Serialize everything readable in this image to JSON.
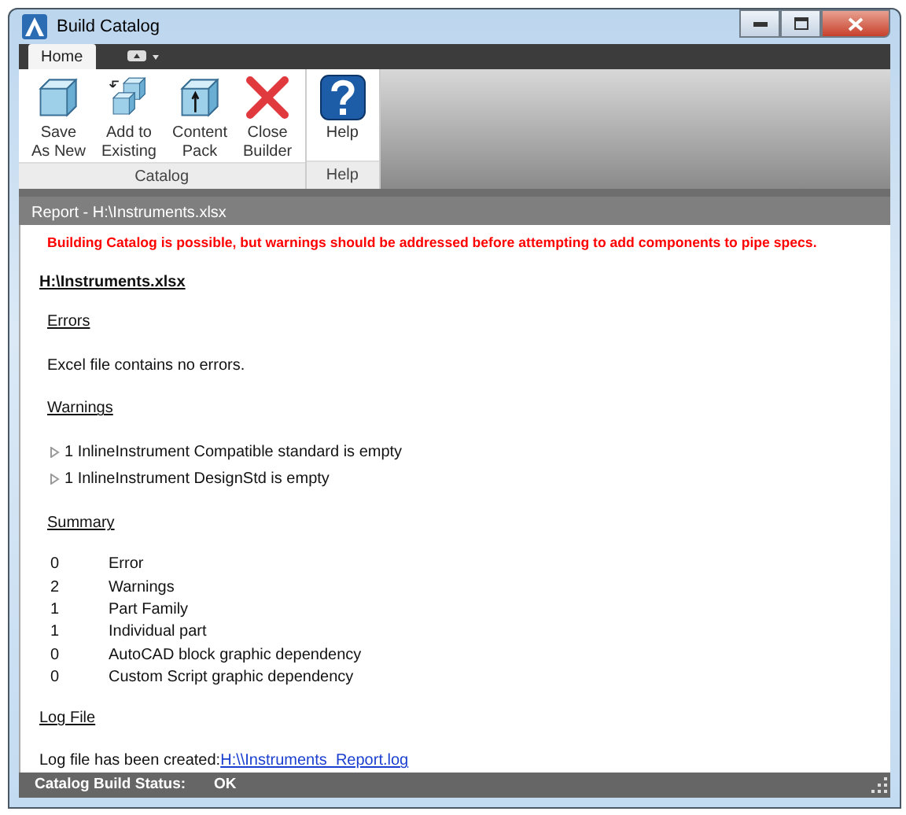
{
  "window": {
    "title": "Build Catalog"
  },
  "ribbon_tabs": [
    {
      "label": "Home",
      "selected": true
    }
  ],
  "ribbon_groups": [
    {
      "label": "Catalog",
      "buttons": [
        {
          "kind": "save",
          "lines": [
            "Save",
            "As New"
          ]
        },
        {
          "kind": "add",
          "lines": [
            "Add to",
            "Existing"
          ]
        },
        {
          "kind": "pack",
          "lines": [
            "Content",
            "Pack"
          ]
        },
        {
          "kind": "close",
          "lines": [
            "Close",
            "Builder"
          ]
        }
      ]
    },
    {
      "label": "Help",
      "buttons": [
        {
          "kind": "help",
          "lines": [
            "Help"
          ]
        }
      ]
    }
  ],
  "report": {
    "title": "Report - H:\\Instruments.xlsx",
    "alert": "Building Catalog is possible, but warnings should be addressed before attempting to add components to pipe specs.",
    "file": "H:\\Instruments.xlsx",
    "errors_heading": "Errors",
    "errors_text": "Excel file contains no errors.",
    "warnings_heading": "Warnings",
    "warnings": [
      {
        "text": "1 InlineInstrument Compatible standard is empty",
        "expanded": false
      },
      {
        "text": "1 InlineInstrument DesignStd is empty",
        "expanded": false
      }
    ],
    "summary_heading": "Summary",
    "summary": [
      {
        "count": "0",
        "label": "Error"
      },
      {
        "count": "2",
        "label": "Warnings"
      },
      {
        "count": "1",
        "label": "Part Family"
      },
      {
        "count": "1",
        "label": "Individual part"
      },
      {
        "count": "0",
        "label": "AutoCAD block graphic dependency"
      },
      {
        "count": "0",
        "label": "Custom Script graphic dependency"
      }
    ],
    "log_heading": "Log File",
    "log_text": "Log file has been created:",
    "log_link": "H:\\\\Instruments_Report.log"
  },
  "status_bar": {
    "label": "Catalog Build Status:",
    "value": "OK"
  }
}
